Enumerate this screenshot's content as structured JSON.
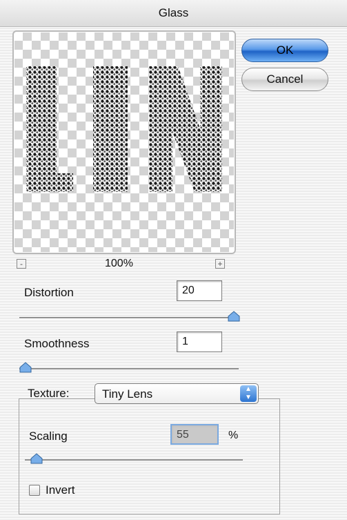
{
  "window": {
    "title": "Glass"
  },
  "buttons": {
    "ok": "OK",
    "cancel": "Cancel"
  },
  "preview": {
    "zoom": "100%",
    "zoom_minus": "-",
    "zoom_plus": "+"
  },
  "distortion": {
    "label": "Distortion",
    "value": "20",
    "slider_fraction": 1.0
  },
  "smoothness": {
    "label": "Smoothness",
    "value": "1",
    "slider_fraction": 0.0
  },
  "texture": {
    "label": "Texture:",
    "selected": "Tiny Lens",
    "scaling": {
      "label": "Scaling",
      "value": "55",
      "unit": "%",
      "slider_fraction": 0.05
    },
    "invert": {
      "label": "Invert",
      "checked": false
    }
  },
  "colors": {
    "ok_button": "#3a7fdc",
    "slider_thumb": "#6fa7e8"
  }
}
